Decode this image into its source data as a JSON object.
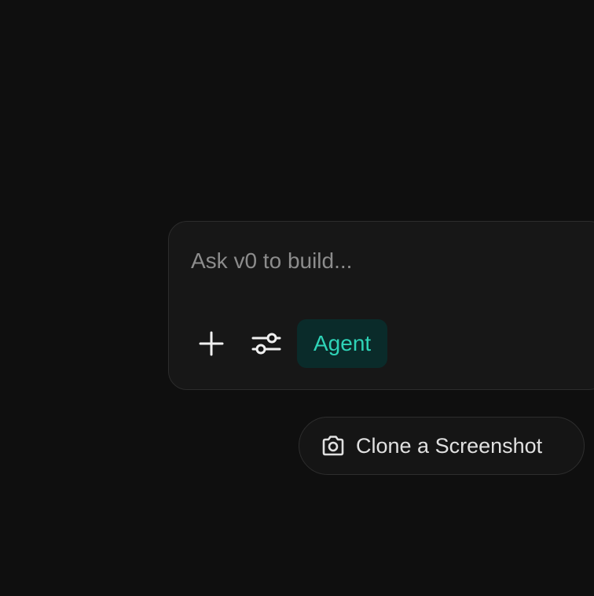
{
  "prompt": {
    "placeholder": "Ask v0 to build...",
    "value": "",
    "add_icon": "plus-icon",
    "settings_icon": "sliders-icon",
    "agent_label": "Agent"
  },
  "actions": {
    "clone_label": "Clone a Screenshot",
    "clone_icon": "camera-icon"
  },
  "colors": {
    "background": "#0f0f0f",
    "accent": "#2ed3b7",
    "accent_bg": "#0a2b2a"
  }
}
